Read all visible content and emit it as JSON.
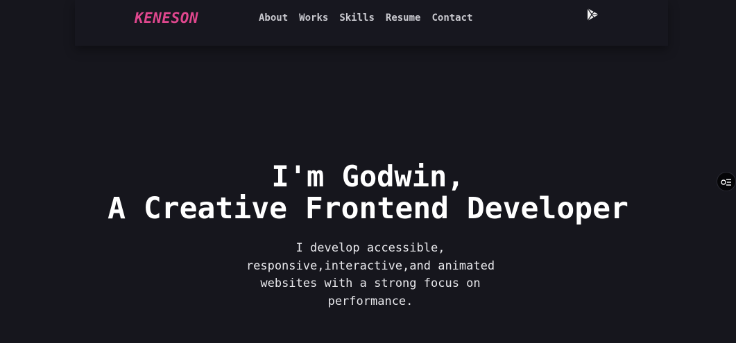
{
  "brand": {
    "logo_text": "KENESON",
    "accent_color": "#e0478e"
  },
  "nav": {
    "items": [
      {
        "label": "About"
      },
      {
        "label": "Works"
      },
      {
        "label": "Skills"
      },
      {
        "label": "Resume"
      },
      {
        "label": "Contact"
      }
    ]
  },
  "header": {
    "play_icon": "play-store-icon"
  },
  "hero": {
    "title_line1": "I'm Godwin,",
    "title_line2": "A Creative Frontend Developer",
    "subtitle": "I develop accessible, responsive,interactive,and animated websites with a strong focus on performance."
  },
  "floating": {
    "settings_icon": "settings-toggle-icon"
  },
  "colors": {
    "background": "#16161d",
    "text": "#ffffff",
    "nav_text": "#c9c9cf"
  }
}
